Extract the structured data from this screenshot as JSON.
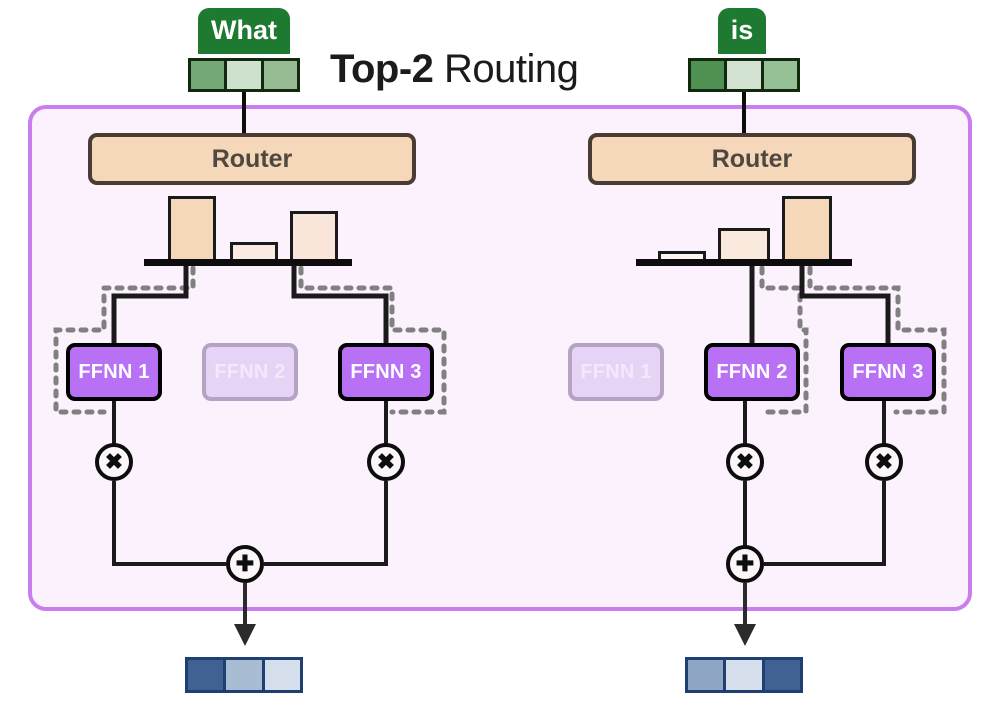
{
  "title": {
    "strong": "Top-2",
    "light": " Routing"
  },
  "colors": {
    "panel_border": "#c97ef0",
    "panel_bg": "#fcf2fd",
    "router_fill": "#f5d7ba",
    "router_border": "#4a3b33",
    "expert_active": "#b870f5",
    "expert_inactive": "#e6d4f7",
    "token_pill": "#1e7a31",
    "embed_border": "#12290f",
    "output_border": "#1d3f72",
    "wire": "#0d0d0d",
    "dotted_path": "#808080"
  },
  "columns": [
    {
      "token": {
        "label": "What",
        "embedding": {
          "cells": [
            {
              "value": 0.62,
              "color": "#74a877"
            },
            {
              "value": 0.18,
              "color": "#cfe2cd"
            },
            {
              "value": 0.46,
              "color": "#97bc93"
            }
          ]
        }
      },
      "router": {
        "label": "Router"
      },
      "chart_data": {
        "type": "bar",
        "title": "Router probabilities",
        "categories": [
          "FFNN 1",
          "FFNN 2",
          "FFNN 3"
        ],
        "values": [
          0.62,
          0.12,
          0.46
        ],
        "colors": [
          "#f5d7ba",
          "#fbeae2",
          "#f9e5da"
        ],
        "ylim": [
          0,
          0.7
        ],
        "xlabel": "",
        "ylabel": "",
        "grid": false,
        "legend": "none"
      },
      "experts": [
        {
          "label": "FFNN 1",
          "state": "active"
        },
        {
          "label": "FFNN 2",
          "state": "inactive"
        },
        {
          "label": "FFNN 3",
          "state": "active"
        }
      ],
      "operators": {
        "multiply": "✖",
        "add": "✚"
      },
      "output": {
        "cells": [
          {
            "value": 0.78,
            "color": "#426193"
          },
          {
            "value": 0.45,
            "color": "#a8bcd4"
          },
          {
            "value": 0.16,
            "color": "#d4dfeb"
          }
        ]
      }
    },
    {
      "token": {
        "label": "is",
        "embedding": {
          "cells": [
            {
              "value": 0.64,
              "color": "#4f9153"
            },
            {
              "value": 0.15,
              "color": "#d3e3d2"
            },
            {
              "value": 0.44,
              "color": "#96c095"
            }
          ]
        }
      },
      "router": {
        "label": "Router"
      },
      "chart_data": {
        "type": "bar",
        "title": "Router probabilities",
        "categories": [
          "FFNN 1",
          "FFNN 2",
          "FFNN 3"
        ],
        "values": [
          0.05,
          0.31,
          0.62
        ],
        "colors": [
          "#fdf6f2",
          "#faeade",
          "#f5d7ba"
        ],
        "ylim": [
          0,
          0.7
        ],
        "xlabel": "",
        "ylabel": "",
        "grid": false,
        "legend": "none"
      },
      "experts": [
        {
          "label": "FFNN 1",
          "state": "inactive"
        },
        {
          "label": "FFNN 2",
          "state": "active"
        },
        {
          "label": "FFNN 3",
          "state": "active"
        }
      ],
      "operators": {
        "multiply": "✖",
        "add": "✚"
      },
      "output": {
        "cells": [
          {
            "value": 0.45,
            "color": "#8fa6c4"
          },
          {
            "value": 0.14,
            "color": "#d4dfeb"
          },
          {
            "value": 0.78,
            "color": "#426193"
          }
        ]
      }
    }
  ]
}
